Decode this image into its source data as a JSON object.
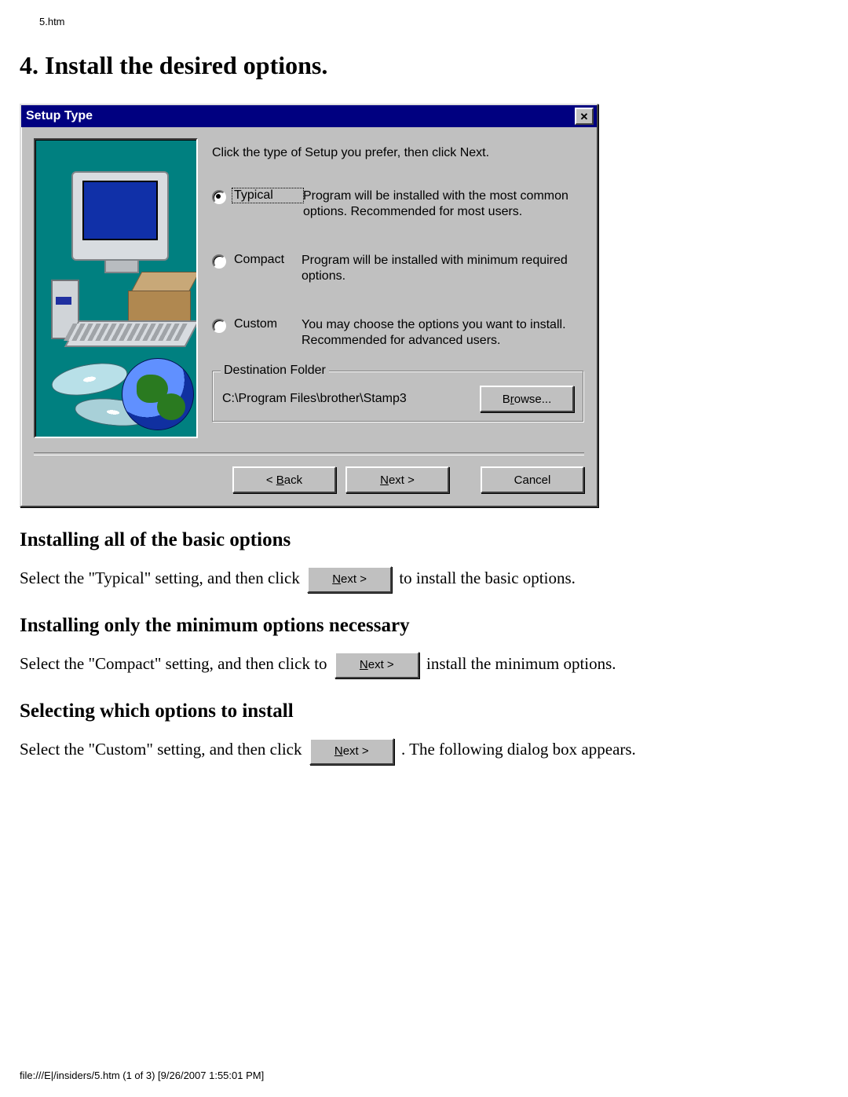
{
  "doc": {
    "crumb": "5.htm",
    "heading": "4. Install the desired options.",
    "sections": [
      {
        "title": "Installing all of the basic options",
        "pre": "Select the \"Typical\" setting, and then click ",
        "btn_pre": "N",
        "btn_rest": "ext >",
        "post": " to install the basic options."
      },
      {
        "title": "Installing only the minimum options necessary",
        "pre": "Select the \"Compact\" setting, and then click to ",
        "btn_pre": "N",
        "btn_rest": "ext >",
        "post": " install the minimum options."
      },
      {
        "title": "Selecting which options to install",
        "pre": "Select the \"Custom\" setting, and then click ",
        "btn_pre": "N",
        "btn_rest": "ext >",
        "post": ". The following dialog box appears."
      }
    ],
    "footer": "file:///E|/insiders/5.htm (1 of 3) [9/26/2007 1:55:01 PM]"
  },
  "dialog": {
    "title": "Setup Type",
    "close": "✕",
    "instruction": "Click the type of Setup you prefer, then click Next.",
    "options": [
      {
        "label": "Typical",
        "desc": "Program will be installed with the most common options. Recommended for most users.",
        "checked": true
      },
      {
        "label": "Compact",
        "desc": "Program will be installed with minimum required options.",
        "checked": false
      },
      {
        "label": "Custom",
        "desc": "You may choose the options you want to install. Recommended for advanced users.",
        "checked": false
      }
    ],
    "group_title": "Destination Folder",
    "path": "C:\\Program Files\\brother\\Stamp3",
    "browse_pre": "B",
    "browse_u": "r",
    "browse_rest": "owse...",
    "back_pre": "< ",
    "back_u": "B",
    "back_rest": "ack",
    "next_u": "N",
    "next_rest": "ext >",
    "cancel": "Cancel"
  }
}
